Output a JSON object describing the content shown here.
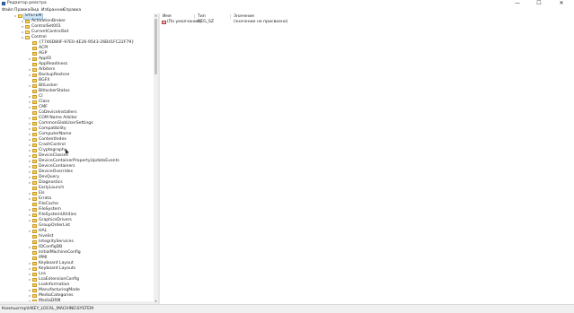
{
  "window": {
    "title": "Редактор реестра",
    "minimize": "—",
    "maximize": "☐",
    "close": "✕"
  },
  "menu": [
    "Файл",
    "Правка",
    "Вид",
    "Избранное",
    "Справка"
  ],
  "tree": [
    {
      "label": "SYSTEM",
      "depth": 1,
      "expander": "∨",
      "open": true,
      "selected": true
    },
    {
      "label": "ActivationBroker",
      "depth": 2,
      "expander": ">"
    },
    {
      "label": "ControlSet001",
      "depth": 2,
      "expander": ">"
    },
    {
      "label": "CurrentControlSet",
      "depth": 2,
      "expander": "∨",
      "open": true
    },
    {
      "label": "Control",
      "depth": 3,
      "expander": "∨",
      "open": true
    },
    {
      "label": "{7746D80F-97E0-4E26-9543-26B41FC22F79}",
      "depth": 4,
      "expander": ""
    },
    {
      "label": "ACPI",
      "depth": 4,
      "expander": ""
    },
    {
      "label": "AGP",
      "depth": 4,
      "expander": ""
    },
    {
      "label": "AppID",
      "depth": 4,
      "expander": ">"
    },
    {
      "label": "AppReadiness",
      "depth": 4,
      "expander": ""
    },
    {
      "label": "Arbiters",
      "depth": 4,
      "expander": ">"
    },
    {
      "label": "BackupRestore",
      "depth": 4,
      "expander": ">"
    },
    {
      "label": "BGFX",
      "depth": 4,
      "expander": ""
    },
    {
      "label": "BitLocker",
      "depth": 4,
      "expander": ">"
    },
    {
      "label": "BitlockerStatus",
      "depth": 4,
      "expander": ""
    },
    {
      "label": "CI",
      "depth": 4,
      "expander": ">"
    },
    {
      "label": "Class",
      "depth": 4,
      "expander": ">"
    },
    {
      "label": "CMF",
      "depth": 4,
      "expander": ">"
    },
    {
      "label": "CoDeviceInstallers",
      "depth": 4,
      "expander": ""
    },
    {
      "label": "COM Name Arbiter",
      "depth": 4,
      "expander": ">"
    },
    {
      "label": "CommonGlobUserSettings",
      "depth": 4,
      "expander": ">"
    },
    {
      "label": "Compatibility",
      "depth": 4,
      "expander": ">"
    },
    {
      "label": "ComputerName",
      "depth": 4,
      "expander": ">"
    },
    {
      "label": "ContentIndex",
      "depth": 4,
      "expander": ">"
    },
    {
      "label": "CrashControl",
      "depth": 4,
      "expander": ">"
    },
    {
      "label": "Cryptography",
      "depth": 4,
      "expander": ">"
    },
    {
      "label": "DeviceClasses",
      "depth": 4,
      "expander": ">"
    },
    {
      "label": "DeviceContainerPropertyUpdateEvents",
      "depth": 4,
      "expander": ">"
    },
    {
      "label": "DeviceContainers",
      "depth": 4,
      "expander": ">"
    },
    {
      "label": "DeviceOverrides",
      "depth": 4,
      "expander": ">"
    },
    {
      "label": "DevQuery",
      "depth": 4,
      "expander": ">"
    },
    {
      "label": "Diagnostics",
      "depth": 4,
      "expander": ">"
    },
    {
      "label": "EarlyLaunch",
      "depth": 4,
      "expander": ""
    },
    {
      "label": "Els",
      "depth": 4,
      "expander": ">"
    },
    {
      "label": "Errata",
      "depth": 4,
      "expander": ">"
    },
    {
      "label": "FileCache",
      "depth": 4,
      "expander": ""
    },
    {
      "label": "FileSystem",
      "depth": 4,
      "expander": ">"
    },
    {
      "label": "FileSystemUtilities",
      "depth": 4,
      "expander": ">"
    },
    {
      "label": "GraphicsDrivers",
      "depth": 4,
      "expander": ">"
    },
    {
      "label": "GroupOrderList",
      "depth": 4,
      "expander": ""
    },
    {
      "label": "HAL",
      "depth": 4,
      "expander": ">"
    },
    {
      "label": "hivelist",
      "depth": 4,
      "expander": ""
    },
    {
      "label": "IntegrityServices",
      "depth": 4,
      "expander": ""
    },
    {
      "label": "IDConfigDB",
      "depth": 4,
      "expander": ">"
    },
    {
      "label": "InitialMachineConfig",
      "depth": 4,
      "expander": ""
    },
    {
      "label": "IPMI",
      "depth": 4,
      "expander": ""
    },
    {
      "label": "Keyboard Layout",
      "depth": 4,
      "expander": ">"
    },
    {
      "label": "Keyboard Layouts",
      "depth": 4,
      "expander": ">"
    },
    {
      "label": "Lsa",
      "depth": 4,
      "expander": ">"
    },
    {
      "label": "LsaExtensionConfig",
      "depth": 4,
      "expander": ">"
    },
    {
      "label": "LsaInformation",
      "depth": 4,
      "expander": ""
    },
    {
      "label": "ManufacturingMode",
      "depth": 4,
      "expander": ">"
    },
    {
      "label": "MediaCategories",
      "depth": 4,
      "expander": ">"
    },
    {
      "label": "MediaDRM",
      "depth": 4,
      "expander": ">"
    }
  ],
  "values": {
    "columns": [
      "Имя",
      "Тип",
      "Значение"
    ],
    "rows": [
      {
        "icon": "ab",
        "name": "(По умолчанию)",
        "type": "REG_SZ",
        "value": "(значение не присвоено)"
      }
    ]
  },
  "status": "Компьютер\\HKEY_LOCAL_MACHINE\\SYSTEM"
}
